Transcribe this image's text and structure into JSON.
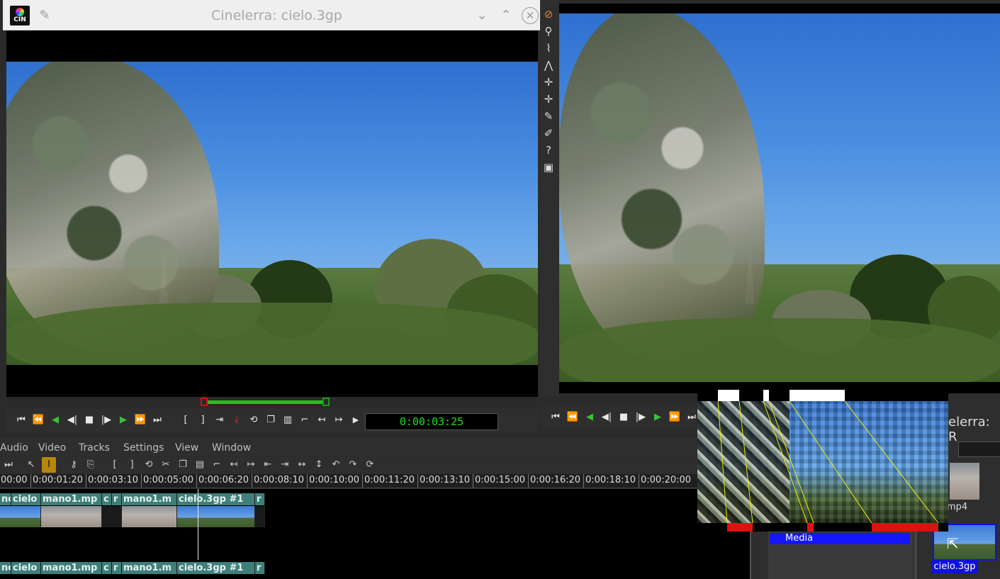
{
  "viewer": {
    "title": "Cinelerra: cielo.3gp",
    "timecode": "0:00:03:25",
    "app_icon": "cin-logo"
  },
  "compositor": {
    "title_partial": "elerra: R"
  },
  "menu": {
    "items": [
      "Audio",
      "Video",
      "Tracks",
      "Settings",
      "View",
      "Window"
    ]
  },
  "ruler": {
    "ticks": [
      "00:00",
      "0:00:01:20",
      "0:00:03:10",
      "0:00:05:00",
      "0:00:06:20",
      "0:00:08:10",
      "0:00:10:00",
      "0:00:11:20",
      "0:00:13:10",
      "0:00:15:00",
      "0:00:16:20",
      "0:00:18:10",
      "0:00:20:00"
    ]
  },
  "timeline": {
    "video_clips": [
      {
        "label": "nc"
      },
      {
        "label": "cielo"
      },
      {
        "label": "mano1.mp"
      },
      {
        "label": "c"
      },
      {
        "label": "r"
      },
      {
        "label": "mano1.m"
      },
      {
        "label": "cielo.3gp #1"
      },
      {
        "label": "r"
      }
    ],
    "audio_clips": [
      {
        "label": "nc"
      },
      {
        "label": "cielo"
      },
      {
        "label": "mano1.mp"
      },
      {
        "label": "c"
      },
      {
        "label": "r"
      },
      {
        "label": "mano1.m"
      },
      {
        "label": "cielo.3gp #1"
      },
      {
        "label": "r"
      }
    ]
  },
  "resources": {
    "folder": "Media",
    "assets": [
      {
        "label": "mp4"
      },
      {
        "label": "cielo.3gp"
      }
    ]
  },
  "colors": {
    "timecode": "#22dd22",
    "clip_title_bg": "#3f7f7a",
    "selection": "#1515ff",
    "progress_green": "#21c021",
    "inpoint_red": "#d01010"
  }
}
